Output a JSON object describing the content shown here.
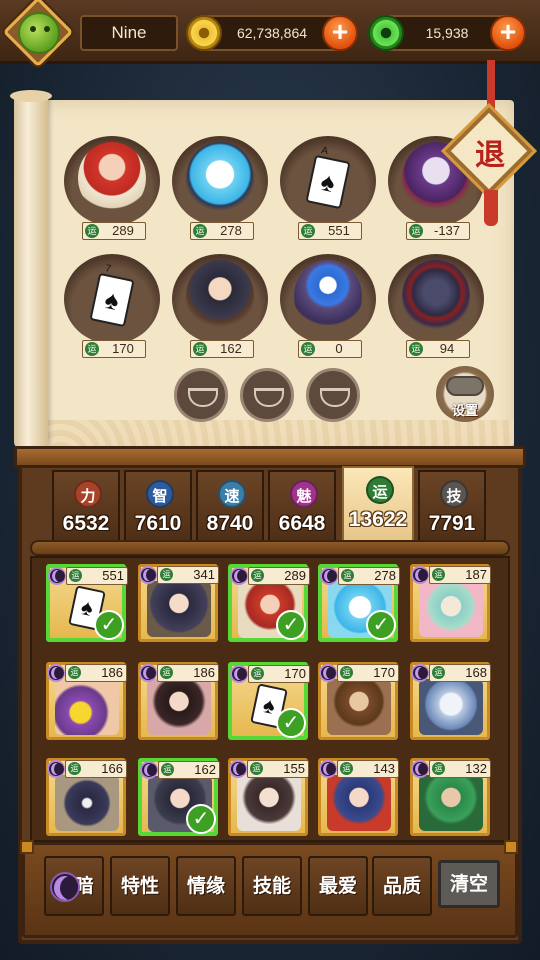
{
  "player": {
    "name": "Nine"
  },
  "resources": {
    "gold": "62,738,864",
    "jade": "15,938"
  },
  "team_slots": [
    {
      "value": "289"
    },
    {
      "value": "278"
    },
    {
      "value": "551"
    },
    {
      "value": "-137"
    },
    {
      "value": "170"
    },
    {
      "value": "162"
    },
    {
      "value": "0"
    },
    {
      "value": "94"
    }
  ],
  "slot_label_icon": "运",
  "exit_label": "退",
  "settings_label": "设置",
  "stats": [
    {
      "icon": "力",
      "value": "6532",
      "color": "#a8432a"
    },
    {
      "icon": "智",
      "value": "7610",
      "color": "#2e5c9a"
    },
    {
      "icon": "速",
      "value": "8740",
      "color": "#3c7ea8"
    },
    {
      "icon": "魅",
      "value": "6648",
      "color": "#a2338c"
    },
    {
      "icon": "运",
      "value": "13622",
      "color": "#2f7d35"
    },
    {
      "icon": "技",
      "value": "7791",
      "color": "#5a5550"
    }
  ],
  "heroes": [
    {
      "value": "551",
      "selected": true
    },
    {
      "value": "341",
      "selected": false
    },
    {
      "value": "289",
      "selected": true
    },
    {
      "value": "278",
      "selected": true
    },
    {
      "value": "187",
      "selected": false
    },
    {
      "value": "186",
      "selected": false
    },
    {
      "value": "186",
      "selected": false
    },
    {
      "value": "170",
      "selected": true
    },
    {
      "value": "170",
      "selected": false
    },
    {
      "value": "168",
      "selected": false
    },
    {
      "value": "166",
      "selected": false
    },
    {
      "value": "162",
      "selected": true
    },
    {
      "value": "155",
      "selected": false
    },
    {
      "value": "143",
      "selected": false
    },
    {
      "value": "132",
      "selected": false
    }
  ],
  "tabs": {
    "dark": "暗",
    "trait": "特性",
    "bond": "情缘",
    "skill": "技能",
    "favorite": "最爱",
    "quality": "品质"
  },
  "clear_label": "清空",
  "check_glyph": "✓",
  "colors": {
    "selected_border": "#56d836",
    "gold_border": "#c98a24"
  }
}
